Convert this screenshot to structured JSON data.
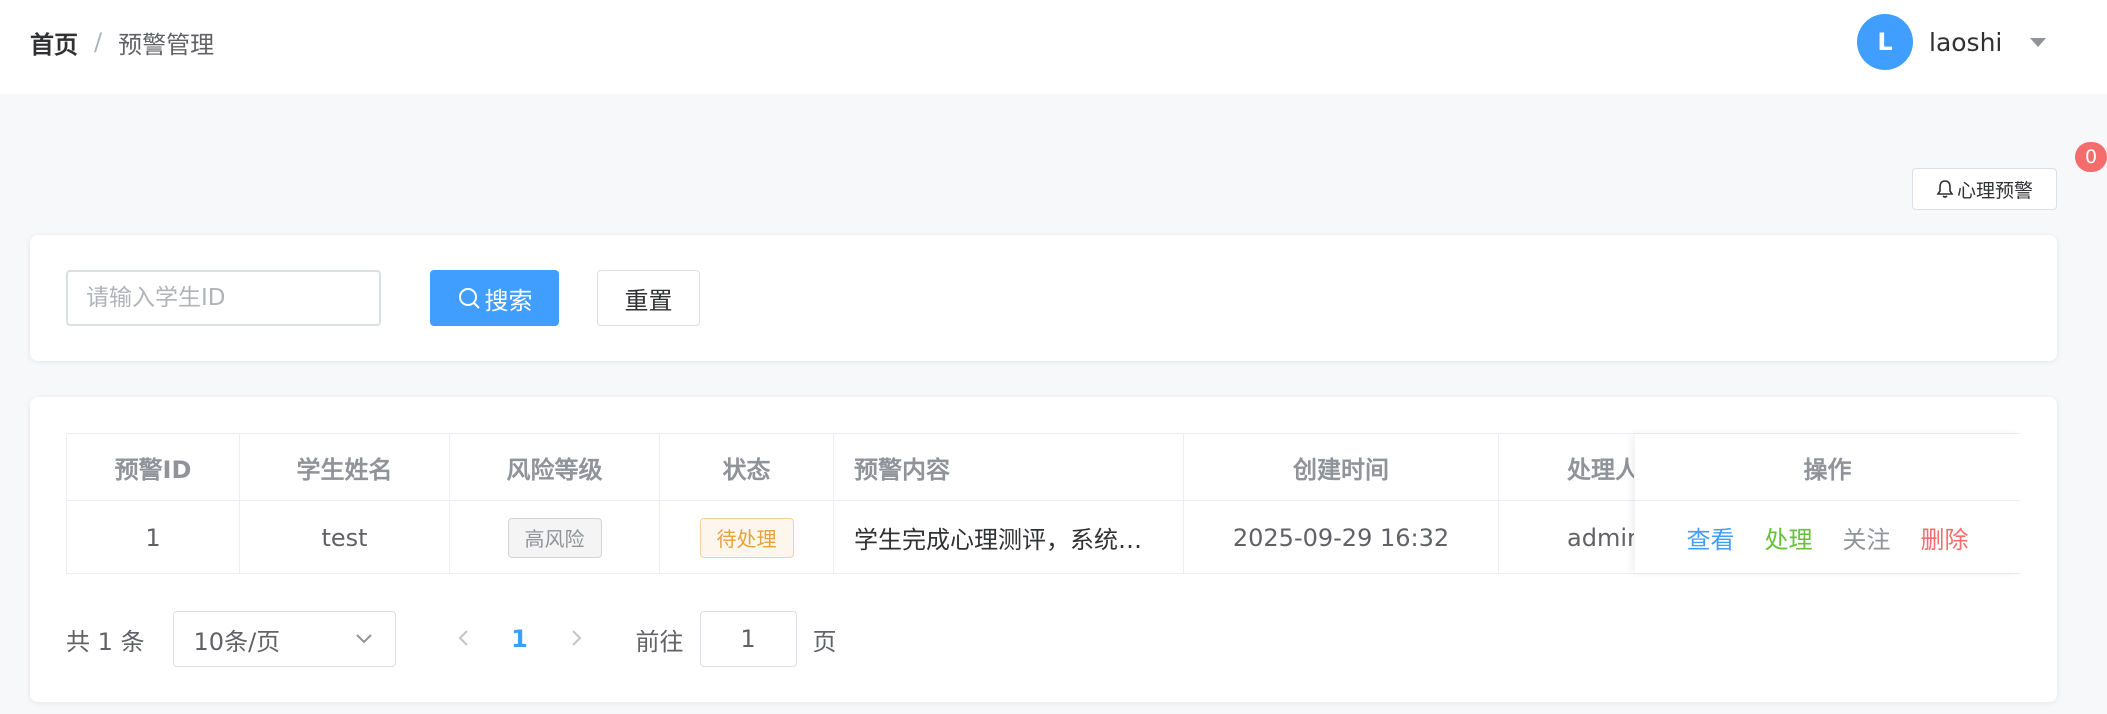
{
  "breadcrumb": {
    "home": "首页",
    "separator": "/",
    "current": "预警管理"
  },
  "user": {
    "avatar_letter": "L",
    "name": "laoshi"
  },
  "alert": {
    "badge_count": "0",
    "button_label": "心理预警"
  },
  "search": {
    "placeholder": "请输入学生ID",
    "value": "",
    "search_label": "搜索",
    "reset_label": "重置"
  },
  "table": {
    "columns": [
      "预警ID",
      "学生姓名",
      "风险等级",
      "状态",
      "预警内容",
      "创建时间",
      "处理人",
      "操作"
    ],
    "rows": [
      {
        "id": "1",
        "student_name": "test",
        "risk_level": "高风险",
        "status": "待处理",
        "content": "学生完成心理测评，系统…",
        "created_at": "2025-09-29 16:32",
        "handler": "admin",
        "actions": {
          "view": "查看",
          "handle": "处理",
          "follow": "关注",
          "delete": "删除"
        }
      }
    ]
  },
  "pagination": {
    "total_label": "共 1 条",
    "page_size": "10条/页",
    "current_page": "1",
    "goto_label": "前往",
    "goto_value": "1",
    "page_unit": "页"
  },
  "colors": {
    "primary": "#409eff",
    "success": "#67c23a",
    "danger": "#f56c6c",
    "warning": "#e6a23c",
    "info": "#909399"
  }
}
